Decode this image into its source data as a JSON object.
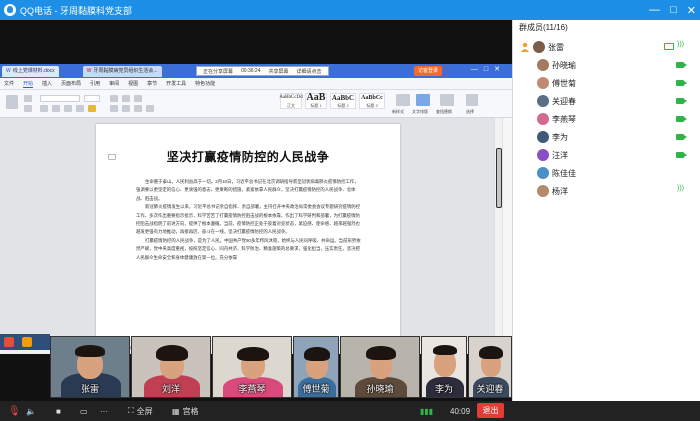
{
  "window": {
    "title": "QQ电话 - 牙周黏膜科党支部",
    "controls": [
      "—",
      "□",
      "✕"
    ]
  },
  "shared_screen": {
    "tabs": [
      {
        "label": "线上党课材料.docx"
      },
      {
        "label": "牙周黏膜病党员组织生活会..."
      }
    ],
    "share_bar": {
      "status": "正在分享屏幕",
      "time": "00:36:24",
      "action": "共享屏幕",
      "note": "详细请点击",
      "stop": "停止分享"
    },
    "login": "访客登录",
    "menu": [
      "文件",
      "开始",
      "插入",
      "页面布局",
      "引用",
      "审阅",
      "视图",
      "章节",
      "开发工具",
      "特色功能"
    ],
    "menu_active_index": 1,
    "styles": [
      {
        "big": "AaBbCcDd",
        "cap": "正文"
      },
      {
        "big": "AaB",
        "cap": "标题 1"
      },
      {
        "big": "AaBbC",
        "cap": "标题 2"
      },
      {
        "big": "AaBbCc",
        "cap": "标题 3"
      }
    ],
    "tool_labels": [
      "新样式",
      "文字排版",
      "查找替换",
      "选择"
    ],
    "document": {
      "title": "坚决打赢疫情防控的人民战争",
      "paragraphs": [
        "生命重于泰山，人民利益高于一切。2月10日，习近平总书记在北京调研指导新型冠状病毒肺炎疫情防控工作，强调要以更坚定的信心、更顽强的意志、更果断的措施，紧紧依靠人民群众，坚决打赢疫情防控的人民战争、总体战、阻击战。",
        "新冠肺炎疫情发生以来，习近平总书记亲自指挥、亲自部署，主持召开中央政治局常委会会议专题研究疫情防控工作，多次作出重要指示批示，科学苦苦了打赢疫情防控阻击战的根本依靠，作出了科学研判和部署，为打赢疫情防控阻击战指明了前进方向，提供了根本遵循。当前，疫情防控正处于胶着对垒状态，紧迫感、使命感、越来越强烈也越发更强有力地推动，再接再厉、奋斗在一线，坚决打赢疫情防控的人民战争。",
        "打赢疫情防控的人民战争，是为了人民。中国共产党90多年栉风沐雨，始终与人民同呼吸、共命运。当前形势依然严峻，党中央高度重视，按照坚定信心、同舟共济、科学防治、精准施策的总要求，强化担当，压实责任，坚决把人民群众生命安全和身体健康放在第一位。充分依靠"
      ]
    },
    "status_bar": [
      "页码: 1",
      "页面: 1/2",
      "节: 1/1",
      "设置值: 2.5厘米",
      "行: 1",
      "列: 13",
      "字数: 1062",
      "拼写检查"
    ],
    "collapse_label": "收起"
  },
  "participants": [
    {
      "name": "张雷"
    },
    {
      "name": "刘洋"
    },
    {
      "name": "李燕琴"
    },
    {
      "name": "傅世菊"
    },
    {
      "name": "孙晓瑜"
    },
    {
      "name": "李为"
    },
    {
      "name": "关迎春"
    }
  ],
  "controls": {
    "fullscreen": "全屏",
    "grid": "宫格",
    "time": "40:09",
    "hangup": "退出"
  },
  "panel": {
    "title": "群成员(11/16)",
    "members": [
      {
        "name": "张雷",
        "status": "share"
      },
      {
        "name": "孙晓瑜",
        "status": "camera"
      },
      {
        "name": "傅世菊",
        "status": "camera"
      },
      {
        "name": "关迎春",
        "status": "camera"
      },
      {
        "name": "李燕琴",
        "status": "camera"
      },
      {
        "name": "李为",
        "status": "camera"
      },
      {
        "name": "汪洋",
        "status": "camera"
      },
      {
        "name": "陈佳佳",
        "status": "none"
      },
      {
        "name": "杨洋",
        "status": "voice"
      }
    ]
  },
  "colors": {
    "title_bar": "#1e8fe6",
    "hangup": "#e33c36",
    "status_green": "#2fb34a"
  }
}
